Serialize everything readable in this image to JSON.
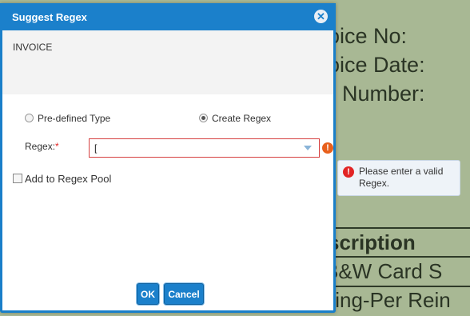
{
  "background_document": {
    "lines": [
      "oice No:",
      "oice Date:",
      "Number:",
      "scription",
      "B&W Card S",
      "ting-Per Rein"
    ]
  },
  "dialog": {
    "title": "Suggest Regex",
    "close_icon": "close-circle-icon",
    "preview_text": "INVOICE",
    "type_options": [
      {
        "label": "Pre-defined Type",
        "checked": false
      },
      {
        "label": "Create Regex",
        "checked": true
      }
    ],
    "regex_label": "Regex:",
    "required_marker": "*",
    "regex_value": "[",
    "pool_checkbox_label": "Add to Regex Pool",
    "pool_checked": false,
    "ok_label": "OK",
    "cancel_label": "Cancel"
  },
  "validation": {
    "tooltip_text": "Please enter a valid Regex.",
    "icon": "error-icon"
  },
  "colors": {
    "header": "#1b80cb",
    "error": "#e22424",
    "input_border_error": "#d64040"
  }
}
